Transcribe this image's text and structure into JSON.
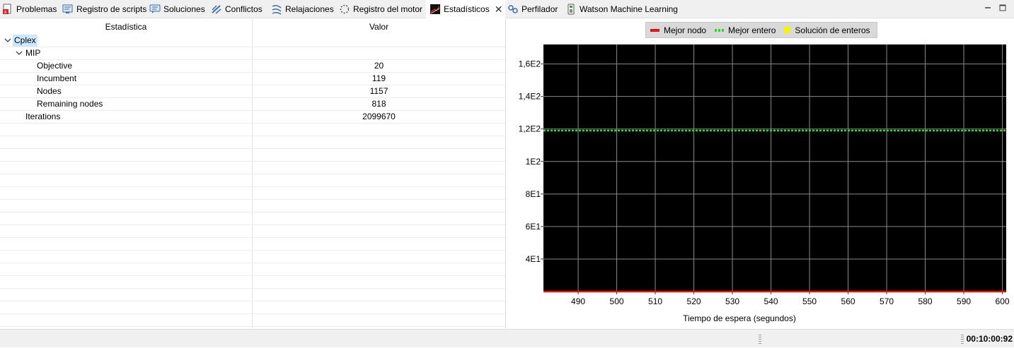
{
  "tabs": [
    {
      "label": "Problemas",
      "icon": "problems-icon"
    },
    {
      "label": "Registro de scripts",
      "icon": "script-log-icon"
    },
    {
      "label": "Soluciones",
      "icon": "solutions-icon"
    },
    {
      "label": "Conflictos",
      "icon": "conflicts-icon"
    },
    {
      "label": "Relajaciones",
      "icon": "relaxations-icon"
    },
    {
      "label": "Registro del motor",
      "icon": "engine-log-icon"
    },
    {
      "label": "Estadísticos",
      "icon": "statistics-icon",
      "active": true
    },
    {
      "label": "Perfilador",
      "icon": "profiler-icon"
    },
    {
      "label": "Watson Machine Learning",
      "icon": "watson-ml-icon"
    }
  ],
  "table": {
    "headers": [
      "Estadística",
      "Valor"
    ],
    "rows": [
      {
        "name": "Cplex",
        "value": "",
        "expanded": true,
        "selected": true
      },
      {
        "name": "MIP",
        "value": "",
        "expanded": true
      },
      {
        "name": "Objective",
        "value": "20"
      },
      {
        "name": "Incumbent",
        "value": "119"
      },
      {
        "name": "Nodes",
        "value": "1157"
      },
      {
        "name": "Remaining nodes",
        "value": "818"
      },
      {
        "name": "Iterations",
        "value": "2099670"
      }
    ]
  },
  "chart_data": {
    "type": "line",
    "xlabel": "Tiempo de espera (segundos)",
    "ylabel": "",
    "xlim": [
      481,
      601
    ],
    "ylim": [
      20,
      172
    ],
    "x_ticks": [
      490,
      500,
      510,
      520,
      530,
      540,
      550,
      560,
      570,
      580,
      590,
      600
    ],
    "y_ticks": [
      {
        "value": 40,
        "label": "4E1"
      },
      {
        "value": 60,
        "label": "6E1"
      },
      {
        "value": 80,
        "label": "8E1"
      },
      {
        "value": 100,
        "label": "1E2"
      },
      {
        "value": 120,
        "label": "1,2E2"
      },
      {
        "value": 140,
        "label": "1,4E2"
      },
      {
        "value": 160,
        "label": "1,6E2"
      }
    ],
    "grid": true,
    "legend_position": "top-center",
    "series": [
      {
        "name": "Mejor nodo",
        "color": "#e81010",
        "style": "solid",
        "points": [
          [
            481,
            20
          ],
          [
            601,
            20
          ]
        ]
      },
      {
        "name": "Mejor entero",
        "color": "#22e022",
        "style": "dashed",
        "points": [
          [
            481,
            119
          ],
          [
            601,
            119
          ]
        ]
      },
      {
        "name": "Solución de enteros",
        "color": "#f5f500",
        "style": "square",
        "points": []
      }
    ],
    "plot_background": "#000000",
    "grid_color": "#8a8a8a"
  },
  "status": {
    "timer": "00:10:00:92"
  }
}
